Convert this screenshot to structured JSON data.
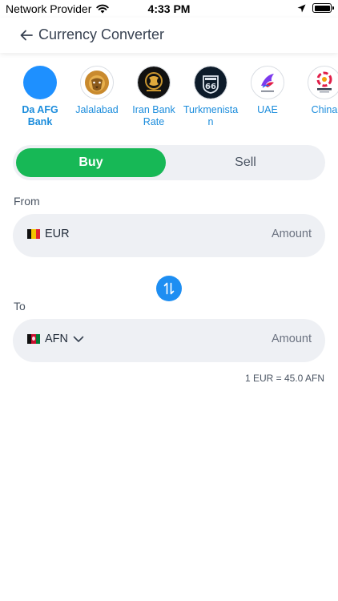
{
  "status_bar": {
    "carrier": "Network Provider",
    "time": "4:33 PM"
  },
  "header": {
    "title": "Currency Converter"
  },
  "banks": [
    {
      "name_line1": "Da AFG",
      "name_line2": "Bank",
      "selected": true
    },
    {
      "name_line1": "Jalalabad",
      "name_line2": "",
      "selected": false
    },
    {
      "name_line1": "Iran Bank",
      "name_line2": "Rate",
      "selected": false
    },
    {
      "name_line1": "Turkmenista",
      "name_line2": "n",
      "selected": false
    },
    {
      "name_line1": "UAE",
      "name_line2": "",
      "selected": false
    },
    {
      "name_line1": "China",
      "name_line2": "",
      "selected": false
    }
  ],
  "toggle": {
    "buy_label": "Buy",
    "sell_label": "Sell",
    "active": "buy"
  },
  "from": {
    "label": "From",
    "currency": "EUR",
    "amount_placeholder": "Amount"
  },
  "to": {
    "label": "To",
    "currency": "AFN",
    "amount_placeholder": "Amount"
  },
  "rate_text": "1 EUR = 45.0 AFN",
  "colors": {
    "accent_green": "#17b856",
    "accent_blue": "#1e8ef2",
    "link_blue": "#1a8cdc",
    "field_bg": "#eef0f4"
  }
}
